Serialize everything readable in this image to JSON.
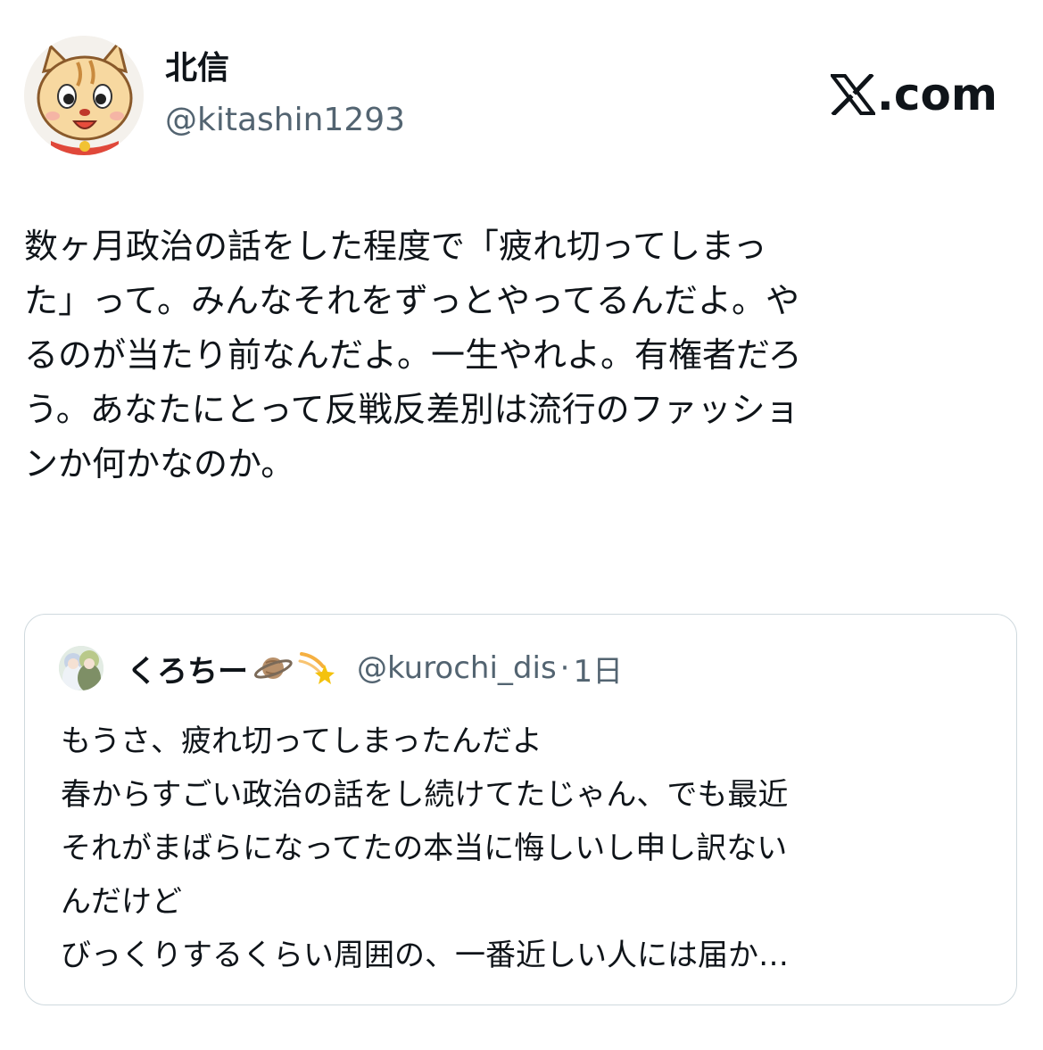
{
  "author": {
    "display_name": "北信",
    "handle": "@kitashin1293",
    "avatar": "cartoon-cat-avatar"
  },
  "brand": {
    "text": ".com",
    "logo": "x-logo-icon"
  },
  "tweet": {
    "lines": [
      "数ヶ月政治の話をした程度で「疲れ切ってしまっ",
      "た」って。みんなそれをずっとやってるんだよ。や",
      "るのが当たり前なんだよ。一生やれよ。有権者だろ",
      "う。あなたにとって反戦反差別は流行のファッショ",
      "ンか何かなのか。"
    ]
  },
  "quoted_tweet": {
    "display_name": "くろちー",
    "emojis": [
      "saturn-icon",
      "shooting-star-icon"
    ],
    "handle": "@kurochi_dis",
    "separator": "·",
    "time": "1日",
    "lines": [
      "もうさ、疲れ切ってしまったんだよ",
      "春からすごい政治の話をし続けてたじゃん、でも最近",
      "それがまばらになってたの本当に悔しいし申し訳ない",
      "んだけど",
      "びっくりするくらい周囲の、一番近しい人には届か…"
    ]
  },
  "colors": {
    "text_primary": "#0f1419",
    "text_secondary": "#536471",
    "border": "#cfd9de"
  }
}
